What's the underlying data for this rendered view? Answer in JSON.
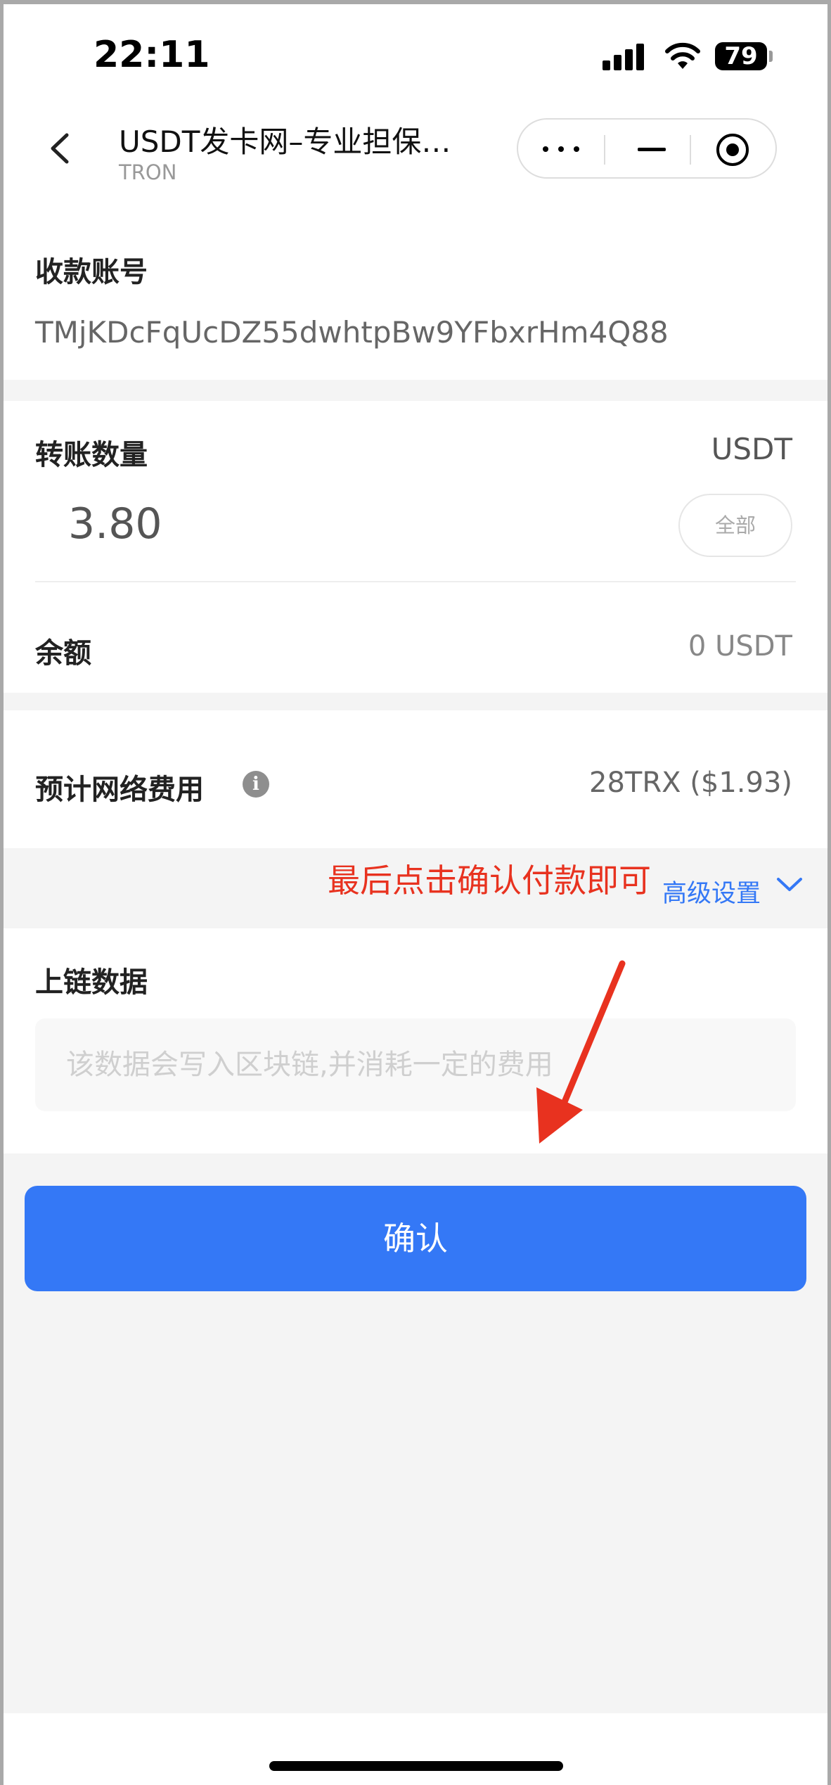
{
  "status": {
    "time": "22:11",
    "battery": "79"
  },
  "nav": {
    "title": "USDT发卡网–专业担保…",
    "subtitle": "TRON"
  },
  "receiver": {
    "label": "收款账号",
    "address": "TMjKDcFqUcDZ55dwhtpBw9YFbxrHm4Q88"
  },
  "transfer": {
    "label": "转账数量",
    "unit": "USDT",
    "amount": "3.80",
    "all_label": "全部",
    "balance_label": "余额",
    "balance_value": "0 USDT"
  },
  "fee": {
    "label": "预计网络费用",
    "info_glyph": "i",
    "value": "28TRX ($1.93)"
  },
  "advanced": {
    "annotation": "最后点击确认付款即可",
    "link": "高级设置"
  },
  "chain_data": {
    "label": "上链数据",
    "placeholder": "该数据会写入区块链,并消耗一定的费用"
  },
  "confirm_label": "确认",
  "colors": {
    "accent": "#3478f6",
    "annotation": "#e8321f"
  }
}
